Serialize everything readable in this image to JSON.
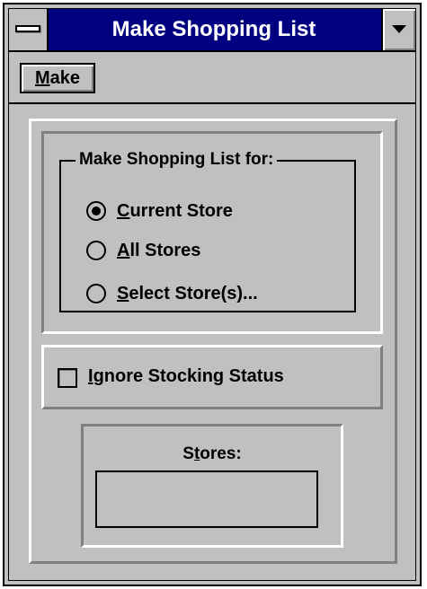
{
  "window": {
    "title": "Make Shopping List",
    "control_menu_icon": "system-menu-bar-icon",
    "minimize_icon": "down-triangle-icon"
  },
  "toolbar": {
    "make_label_mnemonic": "M",
    "make_label_rest": "ake"
  },
  "scope_group": {
    "label": "Make Shopping List for:",
    "options": [
      {
        "mnemonic": "C",
        "rest": "urrent Store",
        "selected": true
      },
      {
        "mnemonic": "A",
        "rest": "ll Stores",
        "selected": false
      },
      {
        "mnemonic": "S",
        "rest": "elect Store(s)...",
        "selected": false
      }
    ]
  },
  "ignore_stocking": {
    "mnemonic": "I",
    "rest": "gnore Stocking Status",
    "checked": false
  },
  "stores": {
    "label_pre": "S",
    "label_mnemonic": "t",
    "label_rest": "ores:",
    "value": ""
  },
  "colors": {
    "titlebar": "#000080",
    "face": "#c0c0c0",
    "highlight": "#ffffff",
    "shadow": "#808080"
  }
}
